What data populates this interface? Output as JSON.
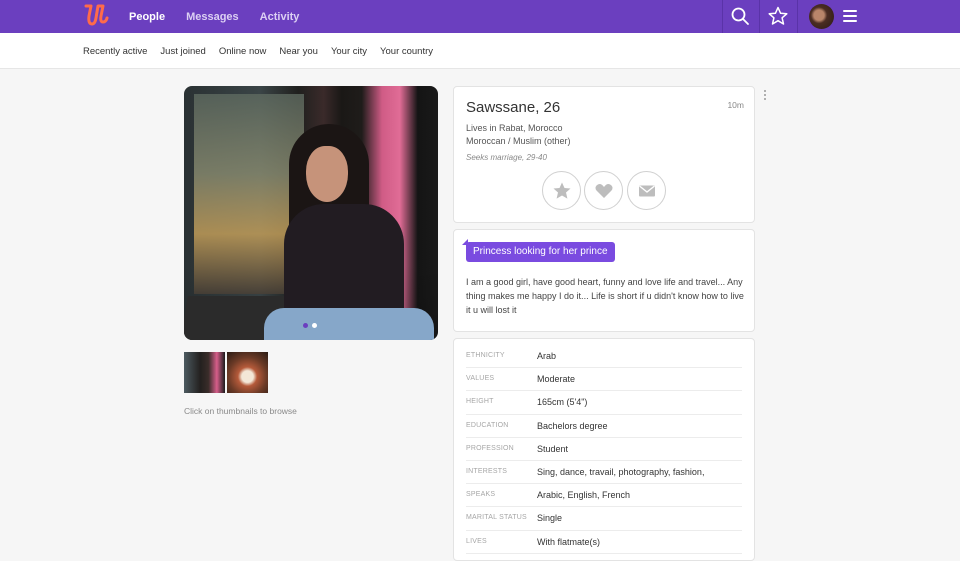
{
  "colors": {
    "brand": "#6b3fbf",
    "accent": "#7a4be0"
  },
  "nav": {
    "logo": "logo",
    "items": [
      {
        "label": "People",
        "active": true
      },
      {
        "label": "Messages",
        "active": false
      },
      {
        "label": "Activity",
        "active": false
      }
    ],
    "icons": [
      "search-icon",
      "star-icon",
      "avatar",
      "menu-icon"
    ]
  },
  "subnav": {
    "items": [
      "Recently active",
      "Just joined",
      "Online now",
      "Near you",
      "Your city",
      "Your country"
    ]
  },
  "photos": {
    "hint": "Click on thumbnails to browse",
    "count": 2,
    "current": 1
  },
  "profile": {
    "name": "Sawssane, 26",
    "time_ago": "10m",
    "lives": "Lives in Rabat, Morocco",
    "ethnicity_religion": "Moroccan / Muslim (other)",
    "seeks": "Seeks marriage, 29-40",
    "actions": [
      "star-icon",
      "heart-icon",
      "envelope-icon"
    ],
    "tagline": "Princess looking for her prince",
    "bio": "I am a good girl, have good heart, funny and love life and travel... Any thing makes me happy I do it... Life is short if u didn't know how to live it u will lost it"
  },
  "attributes": [
    {
      "label": "Ethnicity",
      "value": "Arab"
    },
    {
      "label": "Values",
      "value": "Moderate"
    },
    {
      "label": "Height",
      "value": "165cm (5'4\")"
    },
    {
      "label": "Education",
      "value": "Bachelors degree"
    },
    {
      "label": "Profession",
      "value": "Student"
    },
    {
      "label": "Interests",
      "value": "Sing, dance, travail, photography, fashion,"
    },
    {
      "label": "Speaks",
      "value": "Arabic, English, French"
    },
    {
      "label": "Marital status",
      "value": "Single"
    },
    {
      "label": "Lives",
      "value": "With flatmate(s)"
    }
  ]
}
